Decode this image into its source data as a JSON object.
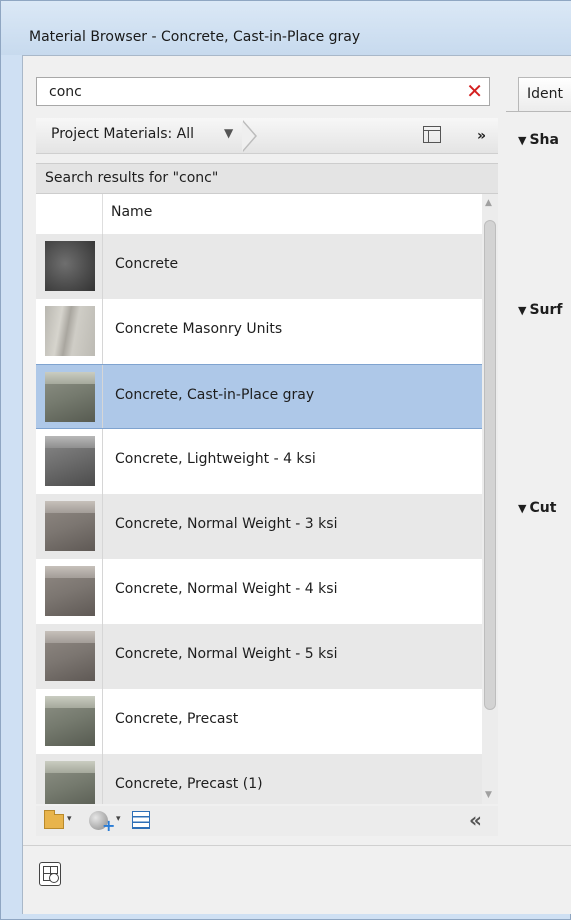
{
  "window": {
    "title": "Material Browser - Concrete, Cast-in-Place gray"
  },
  "search": {
    "value": "conc",
    "clear_icon": "close-x-icon"
  },
  "library": {
    "selector_label": "Project Materials: All",
    "caret": "▼",
    "more": "»"
  },
  "results": {
    "header": "Search results for \"conc\"",
    "column_name": "Name"
  },
  "materials": [
    {
      "name": "Concrete",
      "swatch": "dark"
    },
    {
      "name": "Concrete Masonry Units",
      "swatch": "cmu"
    },
    {
      "name": "Concrete, Cast-in-Place gray",
      "swatch": "cube-green",
      "selected": true
    },
    {
      "name": "Concrete, Lightweight - 4 ksi",
      "swatch": "cube-gray"
    },
    {
      "name": "Concrete, Normal Weight - 3 ksi",
      "swatch": "cube-warm"
    },
    {
      "name": "Concrete, Normal Weight - 4 ksi",
      "swatch": "cube-warm"
    },
    {
      "name": "Concrete, Normal Weight - 5 ksi",
      "swatch": "cube-warm"
    },
    {
      "name": "Concrete, Precast",
      "swatch": "cube-green"
    },
    {
      "name": "Concrete, Precast (1)",
      "swatch": "cube-green"
    }
  ],
  "toolbar": {
    "dropdown_glyph": "▾",
    "collapse_glyph": "«"
  },
  "right_panel": {
    "tab_label": "Ident",
    "sections": [
      {
        "label": "Sha"
      },
      {
        "label": "Surf"
      },
      {
        "label": "Cut"
      }
    ],
    "section_glyph": "▼"
  },
  "colors": {
    "selection": "#aec8e8",
    "accent": "#2d6fb7",
    "clear": "#d42020"
  }
}
